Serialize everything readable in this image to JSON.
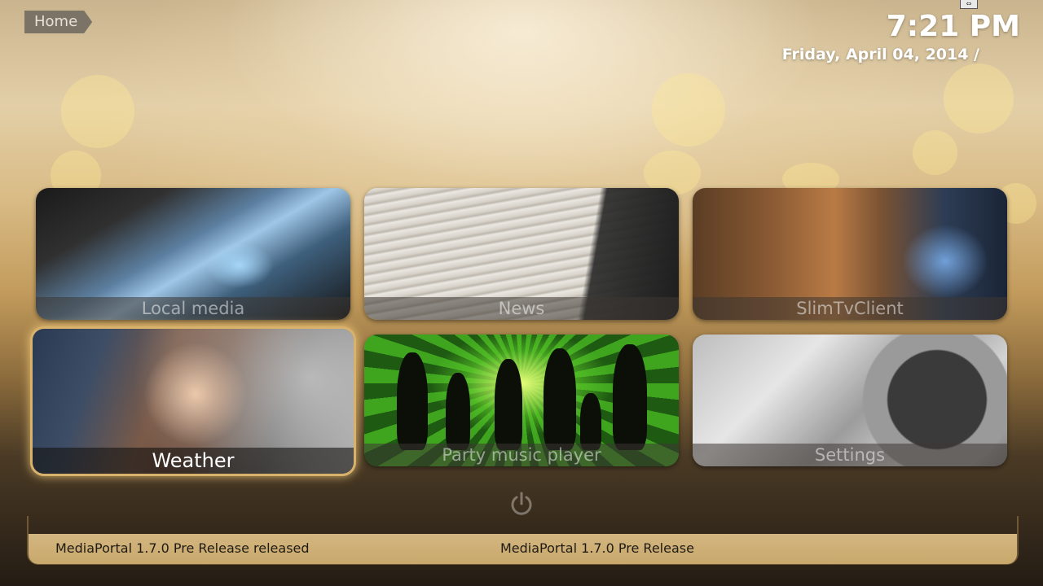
{
  "header": {
    "breadcrumb": "Home",
    "time": "7:21 PM",
    "date": "Friday, April 04, 2014 /"
  },
  "tiles": [
    {
      "label": "Local media",
      "selected": false
    },
    {
      "label": "News",
      "selected": false
    },
    {
      "label": "SlimTvClient",
      "selected": false
    },
    {
      "label": "Weather",
      "selected": true
    },
    {
      "label": "Party music player",
      "selected": false
    },
    {
      "label": "Settings",
      "selected": false
    }
  ],
  "icons": {
    "power": "power-icon",
    "window": "window-restore-icon"
  },
  "footer": {
    "news_ticker": "MediaPortal 1.7.0 Pre Release released",
    "news_title": "MediaPortal 1.7.0 Pre Release"
  },
  "colors": {
    "accent_gold": "#d8b26b",
    "footer_bar": "#ccae74"
  }
}
